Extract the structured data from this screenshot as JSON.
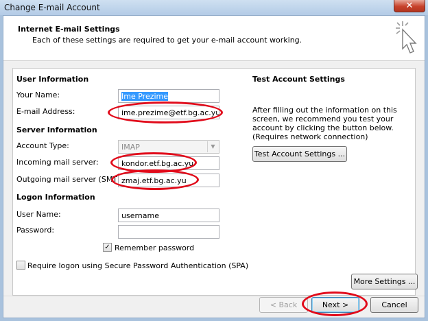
{
  "window": {
    "title": "Change E-mail Account",
    "close_glyph": "✕"
  },
  "header": {
    "title": "Internet E-mail Settings",
    "subtitle": "Each of these settings are required to get your e-mail account working."
  },
  "user_information": {
    "heading": "User Information",
    "your_name_label": "Your Name:",
    "your_name_value": "Ime Prezime",
    "email_label": "E-mail Address:",
    "email_value": "ime.prezime@etf.bg.ac.yu"
  },
  "server_information": {
    "heading": "Server Information",
    "account_type_label": "Account Type:",
    "account_type_value": "IMAP",
    "incoming_label": "Incoming mail server:",
    "incoming_value": "kondor.etf.bg.ac.yu",
    "outgoing_label": "Outgoing mail server (SMTP):",
    "outgoing_value": "zmaj.etf.bg.ac.yu"
  },
  "logon_information": {
    "heading": "Logon Information",
    "username_label": "User Name:",
    "username_value": "username",
    "password_label": "Password:",
    "password_value": "",
    "remember_label": "Remember password",
    "remember_checked": true,
    "spa_label": "Require logon using Secure Password Authentication (SPA)",
    "spa_checked": false
  },
  "test_settings": {
    "heading": "Test Account Settings",
    "description": "After filling out the information on this screen, we recommend you test your account by clicking the button below. (Requires network connection)",
    "button_label": "Test Account Settings ..."
  },
  "buttons": {
    "more_settings": "More Settings ...",
    "back": "< Back",
    "next": "Next >",
    "cancel": "Cancel"
  },
  "icons": {
    "checkmark": "✓",
    "dropdown_arrow": "▼"
  },
  "colors": {
    "annotation_oval": "#e10a1a",
    "selection": "#3399ff"
  }
}
